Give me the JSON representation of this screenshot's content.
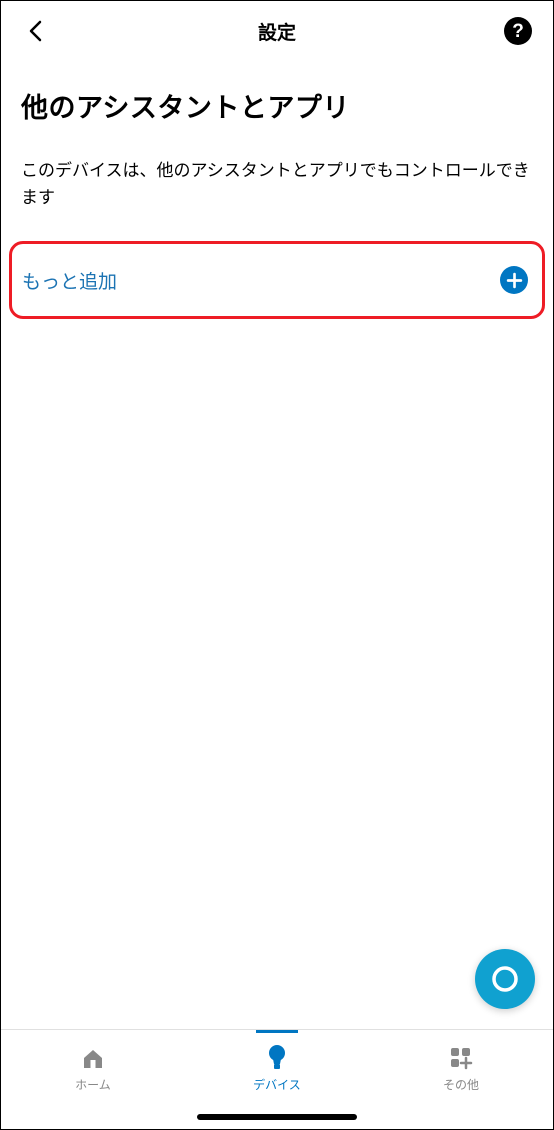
{
  "header": {
    "title": "設定"
  },
  "page": {
    "title": "他のアシスタントとアプリ",
    "description": "このデバイスは、他のアシスタントとアプリでもコントロールできます"
  },
  "add_more": {
    "label": "もっと追加"
  },
  "tabs": {
    "home": "ホーム",
    "devices": "デバイス",
    "more": "その他"
  },
  "colors": {
    "accent": "#0076c2",
    "highlight_border": "#ee1c25",
    "fab": "#10a1d0"
  }
}
